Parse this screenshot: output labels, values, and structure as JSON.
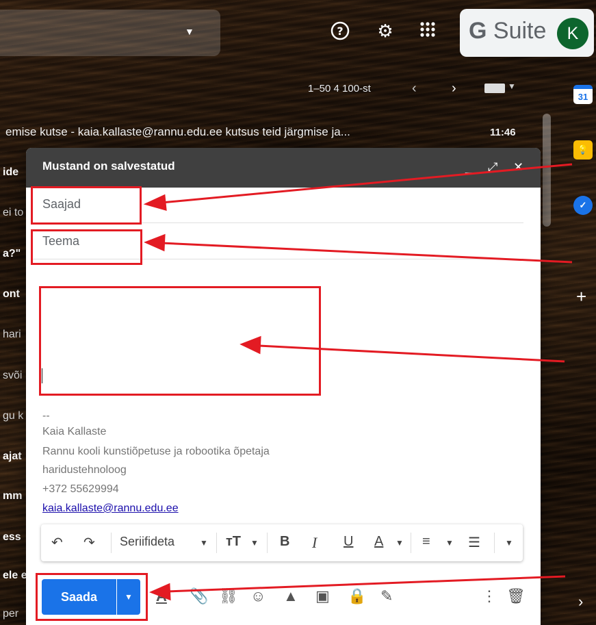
{
  "topbar": {
    "gsuite_g": "G",
    "gsuite_text": " Suite",
    "avatar_letter": "K"
  },
  "toolbar": {
    "pager": "1–50 4 100-st"
  },
  "mail": {
    "subject": "emise kutse - kaia.kallaste@rannu.edu.ee kutsus teid järgmise ja...",
    "time": "11:46",
    "fragments": [
      "ide",
      "ei to",
      "a?\"",
      "ont",
      "hari",
      "svõi",
      "gu k",
      "ajat",
      "mm",
      "ess",
      "ele e",
      "per"
    ]
  },
  "compose": {
    "title": "Mustand on salvestatud",
    "to_placeholder": "Saajad",
    "subject_placeholder": "Teema",
    "signature": {
      "dash": "--",
      "name": "Kaia Kallaste",
      "role": "Rannu kooli kunstiõpetuse ja robootika õpetaja",
      "role2": "haridustehnoloog",
      "phone": "+372 55629994",
      "email": "kaia.kallaste@rannu.edu.ee"
    },
    "font": "Seriifideta",
    "send_label": "Saada"
  },
  "colors": {
    "accent": "#1a73e8",
    "annotation_red": "#e31b23",
    "header": "#404040"
  }
}
